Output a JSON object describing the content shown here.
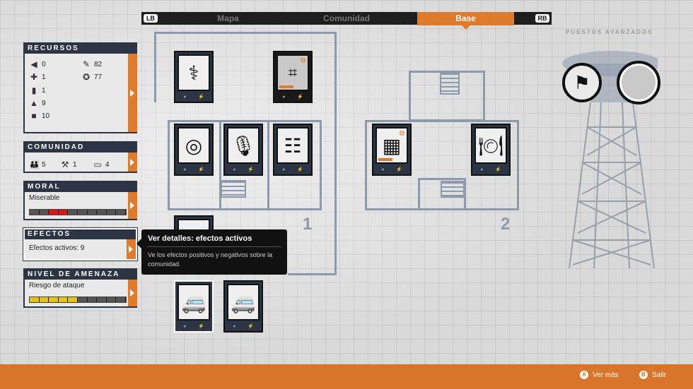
{
  "topbar": {
    "lb": "LB",
    "rb": "RB",
    "tabs": [
      {
        "label": "Mapa"
      },
      {
        "label": "Comunidad"
      },
      {
        "label": "Base",
        "active": true
      }
    ],
    "outposts_label": "PUESTOS AVANZADOS"
  },
  "panels": {
    "recursos": {
      "title": "RECURSOS",
      "items": [
        {
          "icon": "food-icon",
          "value": "0"
        },
        {
          "icon": "medicine-icon",
          "value": "1"
        },
        {
          "icon": "ammo-icon",
          "value": "1"
        },
        {
          "icon": "materials-icon",
          "value": "9"
        },
        {
          "icon": "fuel-icon",
          "value": "10"
        },
        {
          "icon": "influence-icon",
          "value": "82"
        },
        {
          "icon": "prestige-icon",
          "value": "77"
        }
      ]
    },
    "comunidad": {
      "title": "COMUNIDAD",
      "items": [
        {
          "icon": "survivors-icon",
          "value": "5"
        },
        {
          "icon": "workers-icon",
          "value": "1"
        },
        {
          "icon": "beds-icon",
          "value": "4"
        }
      ]
    },
    "moral": {
      "title": "MORAL",
      "value": "Miserable",
      "level": 0.28
    },
    "efectos": {
      "title": "EFECTOS",
      "value": "Efectos activos: 9"
    },
    "amenaza": {
      "title": "NIVEL DE AMENAZA",
      "value": "Riesgo de ataque",
      "level": 0.45
    }
  },
  "tooltip": {
    "title": "Ver detalles: efectos activos",
    "body": "Ve los efectos positivos y negativos sobre la comunidad."
  },
  "blueprint": {
    "site1_number": "1",
    "site2_number": "2"
  },
  "colors": {
    "accent": "#e07b2e",
    "panel_header": "#2b3544",
    "blueprint": "#8d9aab"
  },
  "bottombar": {
    "hints": [
      {
        "glyph": "A",
        "label": "Ver más"
      },
      {
        "glyph": "B",
        "label": "Salir"
      }
    ]
  }
}
